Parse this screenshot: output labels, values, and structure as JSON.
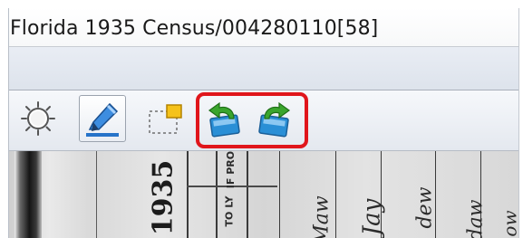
{
  "window": {
    "title": "Florida 1935 Census/004280110[58]"
  },
  "toolbar": {
    "buttons": [
      {
        "name": "brightness",
        "icon": "brightness-icon"
      },
      {
        "name": "highlight",
        "icon": "highlighter-icon",
        "active": true
      },
      {
        "name": "select-area",
        "icon": "marquee-select-icon"
      },
      {
        "name": "rotate-left",
        "icon": "rotate-left-icon"
      },
      {
        "name": "rotate-right",
        "icon": "rotate-right-icon"
      }
    ],
    "highlight_color": "#e0151b"
  },
  "document": {
    "year_text": "1935",
    "column_text_1": "IF  PROP",
    "column_text_2": "TO  LY",
    "handwriting": [
      "Maw",
      "Jay",
      "dew",
      "daw",
      "ow"
    ]
  },
  "colors": {
    "menu_bar": "#dde3ec",
    "toolbar": "#e4e8ef",
    "rotate_icon_green": "#3aa52d",
    "rotate_icon_blue": "#2a8fd6"
  }
}
